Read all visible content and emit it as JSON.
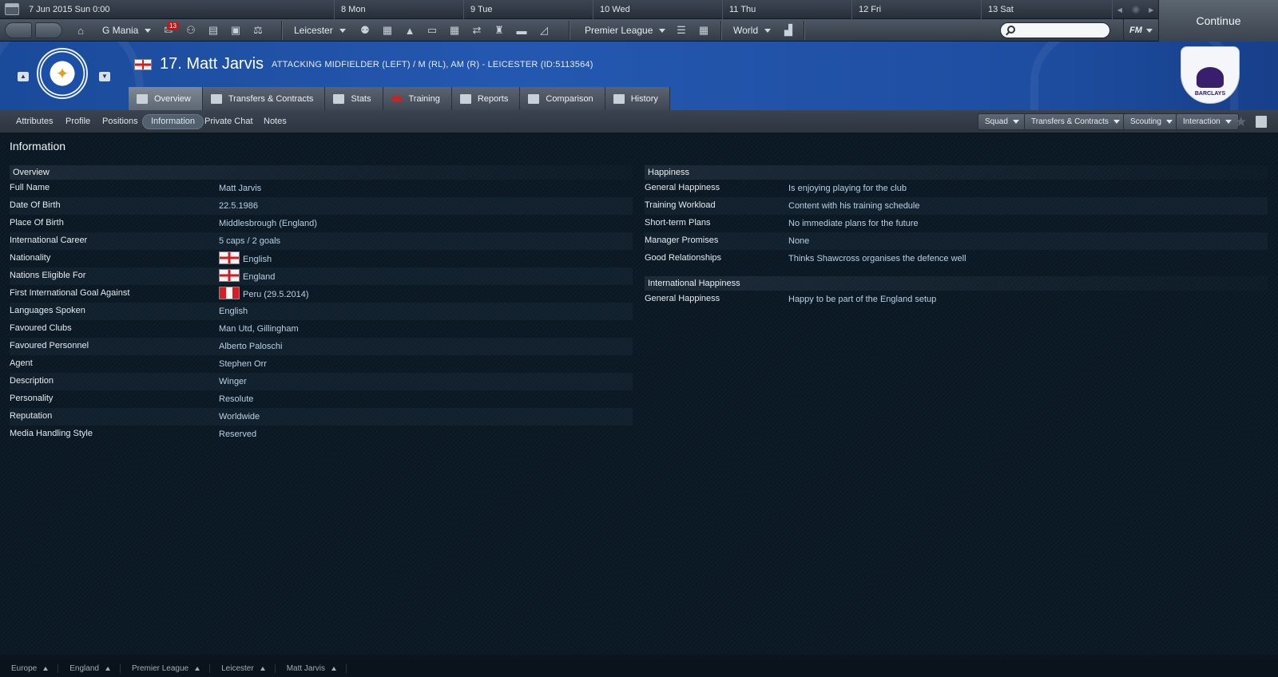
{
  "calendar": {
    "current": "7 Jun 2015  Sun  0:00",
    "days": [
      "8  Mon",
      "9  Tue",
      "10  Wed",
      "11  Thu",
      "12  Fri",
      "13  Sat"
    ]
  },
  "toolbar": {
    "manager": "G Mania",
    "inbox_count": "13",
    "club": "Leicester",
    "competition": "Premier League",
    "world": "World",
    "fm_label": "FM",
    "search_placeholder": "",
    "continue_label": "Continue"
  },
  "header": {
    "player_name": "17. Matt Jarvis",
    "player_subtitle": "ATTACKING MIDFIELDER (LEFT) / M (RL), AM (R) - LEICESTER (ID:5113564)",
    "league_logo_text": "BARCLAYS",
    "tabs": [
      "Overview",
      "Transfers & Contracts",
      "Stats",
      "Training",
      "Reports",
      "Comparison",
      "History"
    ]
  },
  "subtabs": [
    "Attributes",
    "Profile",
    "Positions",
    "Information",
    "Private Chat",
    "Notes"
  ],
  "menus": [
    "Squad",
    "Transfers & Contracts",
    "Scouting",
    "Interaction"
  ],
  "page_title": "Information",
  "overview": {
    "heading": "Overview",
    "rows": [
      {
        "label": "Full Name",
        "value": "Matt Jarvis"
      },
      {
        "label": "Date Of Birth",
        "value": "22.5.1986"
      },
      {
        "label": "Place Of Birth",
        "value": "Middlesbrough (England)"
      },
      {
        "label": "International Career",
        "value": "5 caps / 2 goals"
      },
      {
        "label": "Nationality",
        "value": "English",
        "flag": "england"
      },
      {
        "label": "Nations Eligible For",
        "value": "England",
        "flag": "england"
      },
      {
        "label": "First International Goal Against",
        "value": "Peru (29.5.2014)",
        "flag": "peru"
      },
      {
        "label": "Languages Spoken",
        "value": "English"
      },
      {
        "label": "Favoured Clubs",
        "value": "Man Utd, Gillingham"
      },
      {
        "label": "Favoured Personnel",
        "value": "Alberto Paloschi"
      },
      {
        "label": "Agent",
        "value": "Stephen Orr"
      },
      {
        "label": "Description",
        "value": "Winger"
      },
      {
        "label": "Personality",
        "value": "Resolute"
      },
      {
        "label": "Reputation",
        "value": "Worldwide"
      },
      {
        "label": "Media Handling Style",
        "value": "Reserved"
      }
    ]
  },
  "happiness": {
    "heading": "Happiness",
    "rows": [
      {
        "label": "General Happiness",
        "value": "Is enjoying playing for the club"
      },
      {
        "label": "Training Workload",
        "value": "Content with his training schedule"
      },
      {
        "label": "Short-term Plans",
        "value": "No immediate plans for the future"
      },
      {
        "label": "Manager Promises",
        "value": "None"
      },
      {
        "label": "Good Relationships",
        "value": "Thinks Shawcross organises the defence well"
      }
    ]
  },
  "international_happiness": {
    "heading": "International Happiness",
    "rows": [
      {
        "label": "General Happiness",
        "value": "Happy to be part of the England setup"
      }
    ]
  },
  "breadcrumb": [
    "Europe",
    "England",
    "Premier League",
    "Leicester",
    "Matt Jarvis"
  ]
}
